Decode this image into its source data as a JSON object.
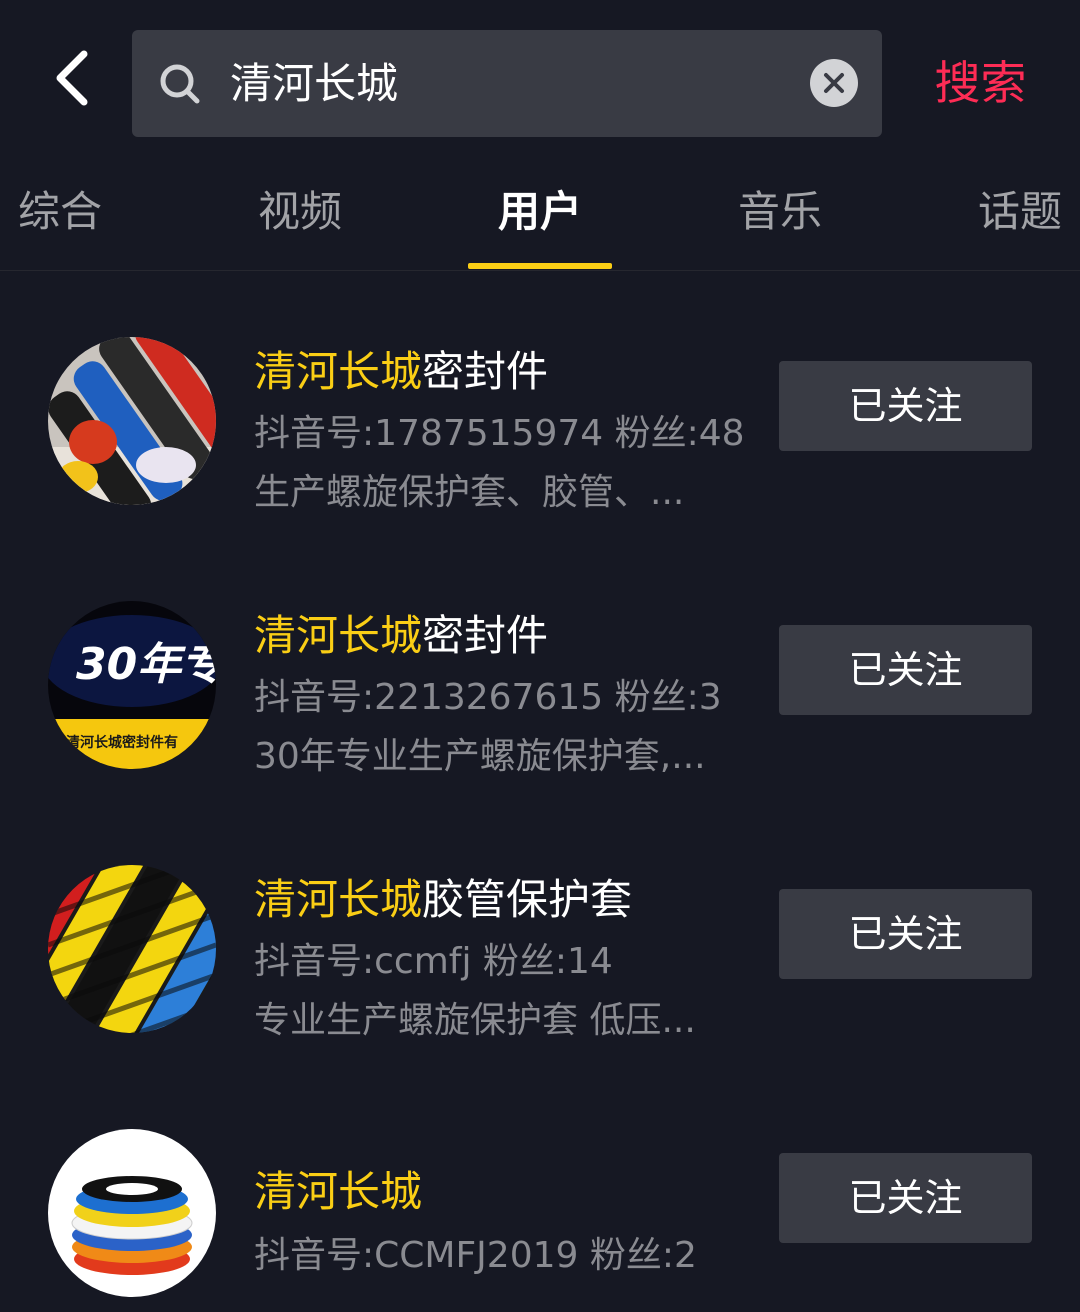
{
  "header": {
    "back_icon": "chevron-left-icon",
    "search_icon": "search-icon",
    "search_value": "清河长城",
    "clear_icon": "close-circle-icon",
    "search_button": "搜索",
    "accent_color": "#fe2c55"
  },
  "tabs": [
    {
      "label": "综合",
      "active": false
    },
    {
      "label": "视频",
      "active": false
    },
    {
      "label": "用户",
      "active": true
    },
    {
      "label": "音乐",
      "active": false
    },
    {
      "label": "话题",
      "active": false
    }
  ],
  "highlight_color": "#face15",
  "users": [
    {
      "name_highlight": "清河长城",
      "name_rest": "密封件",
      "meta": "抖音号:1787515974 粉丝:48",
      "desc": "生产螺旋保护套、胶管、...",
      "follow_label": "已关注"
    },
    {
      "name_highlight": "清河长城",
      "name_rest": "密封件",
      "meta": "抖音号:2213267615 粉丝:3",
      "desc": "30年专业生产螺旋保护套,...",
      "avatar_text": "30年专",
      "avatar_sub": "清河长城密封件有",
      "follow_label": "已关注"
    },
    {
      "name_highlight": "清河长城",
      "name_rest": "胶管保护套",
      "meta": "抖音号:ccmfj 粉丝:14",
      "desc": "专业生产螺旋保护套 低压...",
      "follow_label": "已关注"
    },
    {
      "name_highlight": "清河长城",
      "name_rest": "",
      "meta": "抖音号:CCMFJ2019 粉丝:2",
      "desc": "",
      "follow_label": "已关注"
    }
  ]
}
